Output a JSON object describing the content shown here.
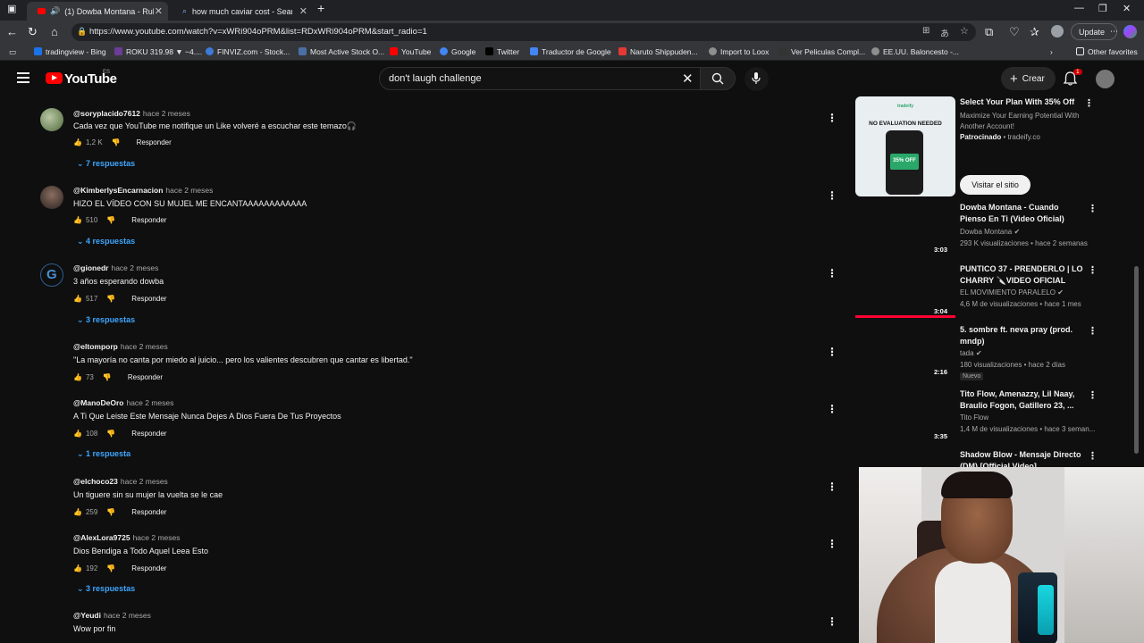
{
  "browser": {
    "tabs": [
      {
        "title": "(1) Dowba Montana - Rulay"
      },
      {
        "title": "how much caviar cost - Search"
      }
    ],
    "url": "https://www.youtube.com/watch?v=xWRi904oPRM&list=RDxWRi904oPRM&start_radio=1",
    "update_label": "Update",
    "bookmarks": [
      {
        "label": "tradingview - Bing",
        "color": "#1a73e8"
      },
      {
        "label": "ROKU 319.98 ▼ −4....",
        "color": "#6c3c97"
      },
      {
        "label": "FINVIZ.com - Stock...",
        "color": "#3d7bd9"
      },
      {
        "label": "Most Active Stock O...",
        "color": "#4a6fa5"
      },
      {
        "label": "YouTube",
        "color": "#ff0000"
      },
      {
        "label": "Google",
        "color": "#4285f4"
      },
      {
        "label": "Twitter",
        "color": "#000000"
      },
      {
        "label": "Traductor de Google",
        "color": "#4285f4"
      },
      {
        "label": "Naruto Shippuden...",
        "color": "#e53935"
      },
      {
        "label": "Import to Loox",
        "color": "#8e8e8e"
      },
      {
        "label": "Ver Peliculas Compl...",
        "color": "#333333"
      },
      {
        "label": "EE.UU. Baloncesto -...",
        "color": "#8e8e8e"
      },
      {
        "label": "Other favorites",
        "color": "#f9ab00"
      }
    ]
  },
  "youtube": {
    "logo_text": "YouTube",
    "region": "ES",
    "search_value": "don't laugh challenge",
    "create_label": "Crear",
    "notification_count": "1"
  },
  "comments": [
    {
      "author": "@soryplacido7612",
      "time": "hace 2 meses",
      "text": "Cada vez que YouTube me notifique un Like volveré a escuchar este temazo🎧",
      "likes": "1,2 K",
      "reply_label": "Responder",
      "replies": "7 respuestas",
      "avatar_color": "#7a8a6a"
    },
    {
      "author": "@KimberlysEncarnacion",
      "time": "hace 2 meses",
      "text": "HIZO EL VÍDEO CON SU MUJEL ME ENCANTAAAAAAAAAAAA",
      "likes": "510",
      "reply_label": "Responder",
      "replies": "4 respuestas",
      "avatar_color": "#5a4a44"
    },
    {
      "author": "@gionedr",
      "time": "hace 2 meses",
      "text": "3 años esperando dowba",
      "likes": "517",
      "reply_label": "Responder",
      "replies": "3 respuestas",
      "avatar_color": "#2d5d8f"
    },
    {
      "author": "@eltomporp",
      "time": "hace 2 meses",
      "text": "\"La mayoría no canta por miedo al juicio... pero los valientes descubren que cantar es libertad.\"",
      "likes": "73",
      "reply_label": "Responder"
    },
    {
      "author": "@ManoDeOro",
      "time": "hace 2 meses",
      "text": "A Ti Que Leiste Este Mensaje Nunca Dejes A Dios Fuera De Tus Proyectos",
      "likes": "108",
      "reply_label": "Responder",
      "replies": "1 respuesta"
    },
    {
      "author": "@elchoco23",
      "time": "hace 2 meses",
      "text": "Un tiguere sin su mujer la vuelta se le cae",
      "likes": "259",
      "reply_label": "Responder"
    },
    {
      "author": "@AlexLora9725",
      "time": "hace 2 meses",
      "text": "Dios Bendiga a Todo Aquel Leea Esto",
      "likes": "192",
      "reply_label": "Responder",
      "replies": "3 respuestas"
    },
    {
      "author": "@Yeudi",
      "time": "hace 2 meses",
      "text": "Wow por fin"
    }
  ],
  "ad": {
    "title": "Select Your Plan With 35% Off",
    "description": "Maximize Your Earning Potential With Another Account!",
    "sponsored_label": "Patrocinado",
    "domain": "tradeify.co",
    "button_label": "Visitar el sitio",
    "thumb_heading": "NO EVALUATION NEEDED",
    "thumb_brand": "tradeify",
    "thumb_offer": "35% OFF"
  },
  "videos": [
    {
      "title": "Dowba Montana - Cuando Pienso En Ti (Video Oficial)",
      "channel": "Dowba Montana",
      "meta": "293 K visualizaciones • hace 2 semanas",
      "duration": "3:03"
    },
    {
      "title": "PUNTICO 37 - PRENDERLO | LO CHARRY 🔪VIDEO OFICIAL",
      "channel": "EL MOVIMIENTO PARALELO",
      "meta": "4,6 M de visualizaciones • hace 1 mes",
      "duration": "3:04",
      "watched_fraction": 1.0
    },
    {
      "title": "5. sombre ft. neva pray (prod. mndp)",
      "channel": "tada",
      "meta": "180 visualizaciones • hace 2 días",
      "duration": "2:16",
      "badge": "Nuevo"
    },
    {
      "title": "Tito Flow, Amenazzy, Lil Naay, Braulio Fogon, Gatillero 23, ...",
      "channel": "Tito Flow",
      "meta": "1,4 M de visualizaciones • hace 3 seman...",
      "duration": "3:35"
    },
    {
      "title": "Shadow Blow - Mensaje Directo (DM) [Official Video]"
    }
  ]
}
